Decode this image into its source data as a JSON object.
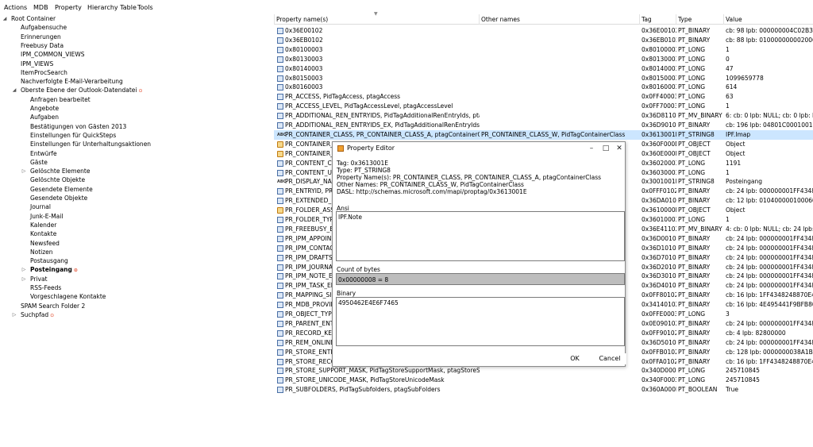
{
  "menu": [
    "Actions",
    "MDB",
    "Property",
    "Hierarchy Table",
    "Tools"
  ],
  "tree": [
    {
      "label": "Root Container",
      "exp": "◢"
    },
    {
      "label": "Aufgabensuche"
    },
    {
      "label": "Erinnerungen"
    },
    {
      "label": "Freebusy Data"
    },
    {
      "label": "IPM_COMMON_VIEWS"
    },
    {
      "label": "IPM_VIEWS"
    },
    {
      "label": "ItemProcSearch"
    },
    {
      "label": "Nachverfolgte E-Mail-Verarbeitung"
    },
    {
      "label": "Oberste Ebene der Outlook-Datendatei",
      "exp": "◢",
      "marker": "⊙"
    },
    {
      "label": "Anfragen bearbeitet"
    },
    {
      "label": "Angebote"
    },
    {
      "label": "Aufgaben"
    },
    {
      "label": "Bestätigungen von Gästen 2013"
    },
    {
      "label": "Einstellungen für QuickSteps"
    },
    {
      "label": "Einstellungen für Unterhaltungsaktionen"
    },
    {
      "label": "Entwürfe"
    },
    {
      "label": "Gäste"
    },
    {
      "label": "Gelöschte Elemente",
      "exp": "▷"
    },
    {
      "label": "Gelöschte Objekte"
    },
    {
      "label": "Gesendete Elemente"
    },
    {
      "label": "Gesendete Objekte"
    },
    {
      "label": "Journal"
    },
    {
      "label": "Junk-E-Mail"
    },
    {
      "label": "Kalender"
    },
    {
      "label": "Kontakte"
    },
    {
      "label": "Newsfeed"
    },
    {
      "label": "Notizen"
    },
    {
      "label": "Postausgang"
    },
    {
      "label": "Posteingang",
      "exp": "▷",
      "bold": true,
      "marker": "⊙"
    },
    {
      "label": "Privat",
      "exp": "▷"
    },
    {
      "label": "RSS-Feeds"
    },
    {
      "label": "Vorgeschlagene Kontakte"
    },
    {
      "label": "SPAM Search Folder 2"
    },
    {
      "label": "Suchpfad",
      "exp": "▷",
      "marker": "⊙"
    }
  ],
  "columns": [
    "Property name(s)",
    "Other names",
    "Tag",
    "Type",
    "Value"
  ],
  "rows": [
    {
      "icon": "bin",
      "name": "0x36E00102",
      "other": "",
      "tag": "0x36E00102",
      "type": "PT_BINARY",
      "value": "cb: 98 lpb: 000000004C02B3005A"
    },
    {
      "icon": "bin",
      "name": "0x36EB0102",
      "other": "",
      "tag": "0x36EB0102",
      "type": "PT_BINARY",
      "value": "cb: 88 lpb: 01000000000200600000"
    },
    {
      "icon": "long",
      "name": "0x80100003",
      "other": "",
      "tag": "0x80100003",
      "type": "PT_LONG",
      "value": "1"
    },
    {
      "icon": "long",
      "name": "0x80130003",
      "other": "",
      "tag": "0x80130003",
      "type": "PT_LONG",
      "value": "0"
    },
    {
      "icon": "long",
      "name": "0x80140003",
      "other": "",
      "tag": "0x80140003",
      "type": "PT_LONG",
      "value": "47"
    },
    {
      "icon": "long",
      "name": "0x80150003",
      "other": "",
      "tag": "0x80150003",
      "type": "PT_LONG",
      "value": "1099659778"
    },
    {
      "icon": "long",
      "name": "0x80160003",
      "other": "",
      "tag": "0x80160003",
      "type": "PT_LONG",
      "value": "614"
    },
    {
      "icon": "long",
      "name": "PR_ACCESS, PidTagAccess, ptagAccess",
      "other": "",
      "tag": "0x0FF40003",
      "type": "PT_LONG",
      "value": "63"
    },
    {
      "icon": "long",
      "name": "PR_ACCESS_LEVEL, PidTagAccessLevel, ptagAccessLevel",
      "other": "",
      "tag": "0x0FF70003",
      "type": "PT_LONG",
      "value": "1"
    },
    {
      "icon": "bin",
      "name": "PR_ADDITIONAL_REN_ENTRYIDS, PidTagAdditionalRenEntryIds, ptagAd...",
      "other": "",
      "tag": "0x36D81102",
      "type": "PT_MV_BINARY",
      "value": "6: cb: 0 lpb: NULL; cb: 0 lpb: NUL"
    },
    {
      "icon": "bin",
      "name": "PR_ADDITIONAL_REN_ENTRYIDS_EX, PidTagAdditionalRenEntryIdsEx, p...",
      "other": "",
      "tag": "0x36D90102",
      "type": "PT_BINARY",
      "value": "cb: 196 lpb: 04801C000100180000"
    },
    {
      "icon": "abc",
      "name": "PR_CONTAINER_CLASS, PR_CONTAINER_CLASS_A, ptagContainerClass",
      "other": "PR_CONTAINER_CLASS_W, PidTagContainerClass",
      "tag": "0x3613001E",
      "type": "PT_STRING8",
      "value": "IPF.Imap",
      "sel": true
    },
    {
      "icon": "obj",
      "name": "PR_CONTAINER_",
      "other": "",
      "tag": "0x360F000D",
      "type": "PT_OBJECT",
      "value": "Object"
    },
    {
      "icon": "obj",
      "name": "PR_CONTAINER_",
      "other": "",
      "tag": "0x360E000D",
      "type": "PT_OBJECT",
      "value": "Object"
    },
    {
      "icon": "long",
      "name": "PR_CONTENT_C",
      "other": "",
      "tag": "0x36020003",
      "type": "PT_LONG",
      "value": "1191"
    },
    {
      "icon": "long",
      "name": "PR_CONTENT_U",
      "other": "",
      "tag": "0x36030003",
      "type": "PT_LONG",
      "value": "1"
    },
    {
      "icon": "abc",
      "name": "PR_DISPLAY_NA",
      "other": "",
      "tag": "0x3001001E",
      "type": "PT_STRING8",
      "value": "Posteingang"
    },
    {
      "icon": "bin",
      "name": "PR_ENTRYID, PR",
      "other": "",
      "tag": "0x0FFF0102",
      "type": "PT_BINARY",
      "value": "cb: 24 lpb: 000000001FF43482488"
    },
    {
      "icon": "bin",
      "name": "PR_EXTENDED_F",
      "other": "",
      "tag": "0x36DA0102",
      "type": "PT_BINARY",
      "value": "cb: 12 lpb: 010400000100060403C"
    },
    {
      "icon": "obj",
      "name": "PR_FOLDER_ASS",
      "other": "",
      "tag": "0x3610000D",
      "type": "PT_OBJECT",
      "value": "Object"
    },
    {
      "icon": "long",
      "name": "PR_FOLDER_TYP",
      "other": "",
      "tag": "0x36010003",
      "type": "PT_LONG",
      "value": "1"
    },
    {
      "icon": "bin",
      "name": "PR_FREEBUSY_EN",
      "other": "",
      "tag": "0x36E41102",
      "type": "PT_MV_BINARY",
      "value": "4: cb: 0 lpb: NULL; cb: 24 lpb: 000"
    },
    {
      "icon": "bin",
      "name": "PR_IPM_APPOIN",
      "other": "",
      "tag": "0x36D00102",
      "type": "PT_BINARY",
      "value": "cb: 24 lpb: 000000001FF43482488"
    },
    {
      "icon": "bin",
      "name": "PR_IPM_CONTAC",
      "other": "",
      "tag": "0x36D10102",
      "type": "PT_BINARY",
      "value": "cb: 24 lpb: 000000001FF43482488"
    },
    {
      "icon": "bin",
      "name": "PR_IPM_DRAFTS_",
      "other": "",
      "tag": "0x36D70102",
      "type": "PT_BINARY",
      "value": "cb: 24 lpb: 000000001FF43482488"
    },
    {
      "icon": "bin",
      "name": "PR_IPM_JOURNA",
      "other": "",
      "tag": "0x36D20102",
      "type": "PT_BINARY",
      "value": "cb: 24 lpb: 000000001FF43482488"
    },
    {
      "icon": "bin",
      "name": "PR_IPM_NOTE_E",
      "other": "",
      "tag": "0x36D30102",
      "type": "PT_BINARY",
      "value": "cb: 24 lpb: 000000001FF43482488"
    },
    {
      "icon": "bin",
      "name": "PR_IPM_TASK_EN",
      "other": "",
      "tag": "0x36D40102",
      "type": "PT_BINARY",
      "value": "cb: 24 lpb: 000000001FF43482488"
    },
    {
      "icon": "bin",
      "name": "PR_MAPPING_SIG",
      "other": "",
      "tag": "0x0FF80102",
      "type": "PT_BINARY",
      "value": "cb: 16 lpb: 1FF4348248870E4399B"
    },
    {
      "icon": "bin",
      "name": "PR_MDB_PROVID",
      "other": "",
      "tag": "0x34140102",
      "type": "PT_BINARY",
      "value": "cb: 16 lpb: 4E495441F9BFB80100A"
    },
    {
      "icon": "long",
      "name": "PR_OBJECT_TYPE",
      "other": "",
      "tag": "0x0FFE0003",
      "type": "PT_LONG",
      "value": "3"
    },
    {
      "icon": "bin",
      "name": "PR_PARENT_ENT",
      "other": "",
      "tag": "0x0E090102",
      "type": "PT_BINARY",
      "value": "cb: 24 lpb: 000000001FF43482488"
    },
    {
      "icon": "bin",
      "name": "PR_RECORD_KEY",
      "other": "",
      "tag": "0x0FF90102",
      "type": "PT_BINARY",
      "value": "cb: 4 lpb: 82800000"
    },
    {
      "icon": "bin",
      "name": "PR_REM_ONLINE",
      "other": "",
      "tag": "0x36D50102",
      "type": "PT_BINARY",
      "value": "cb: 24 lpb: 000000001FF43482488"
    },
    {
      "icon": "bin",
      "name": "PR_STORE_ENTR",
      "other": "",
      "tag": "0x0FFB0102",
      "type": "PT_BINARY",
      "value": "cb: 128 lpb: 0000000038A1BB1005"
    },
    {
      "icon": "bin",
      "name": "PR_STORE_RECO",
      "other": "",
      "tag": "0x0FFA0102",
      "type": "PT_BINARY",
      "value": "cb: 16 lpb: 1FF4348248870E4399B"
    },
    {
      "icon": "long",
      "name": "PR_STORE_SUPPORT_MASK, PidTagStoreSupportMask, ptagStoreSuppo...",
      "other": "",
      "tag": "0x340D0003",
      "type": "PT_LONG",
      "value": "245710845"
    },
    {
      "icon": "long",
      "name": "PR_STORE_UNICODE_MASK, PidTagStoreUnicodeMask",
      "other": "",
      "tag": "0x340F0003",
      "type": "PT_LONG",
      "value": "245710845"
    },
    {
      "icon": "bin",
      "name": "PR_SUBFOLDERS, PidTagSubfolders, ptagSubFolders",
      "other": "",
      "tag": "0x360A000B",
      "type": "PT_BOOLEAN",
      "value": "True"
    }
  ],
  "dialog": {
    "title": "Property Editor",
    "minimize": "–",
    "maximize": "□",
    "close": "✕",
    "tag_line": "Tag: 0x3613001E",
    "type_line": "Type: PT_STRING8",
    "names_line": "Property Name(s): PR_CONTAINER_CLASS, PR_CONTAINER_CLASS_A, ptagContainerClass",
    "other_line": "Other Names: PR_CONTAINER_CLASS_W, PidTagContainerClass",
    "dasl_line": "DASL: http://schemas.microsoft.com/mapi/proptag/0x3613001E",
    "ansi_label": "Ansi",
    "ansi_value": "IPF.Note",
    "count_label": "Count of bytes",
    "count_value": "0x00000008 = 8",
    "binary_label": "Binary",
    "binary_value": "4950462E4E6F7465",
    "ok": "OK",
    "cancel": "Cancel"
  }
}
